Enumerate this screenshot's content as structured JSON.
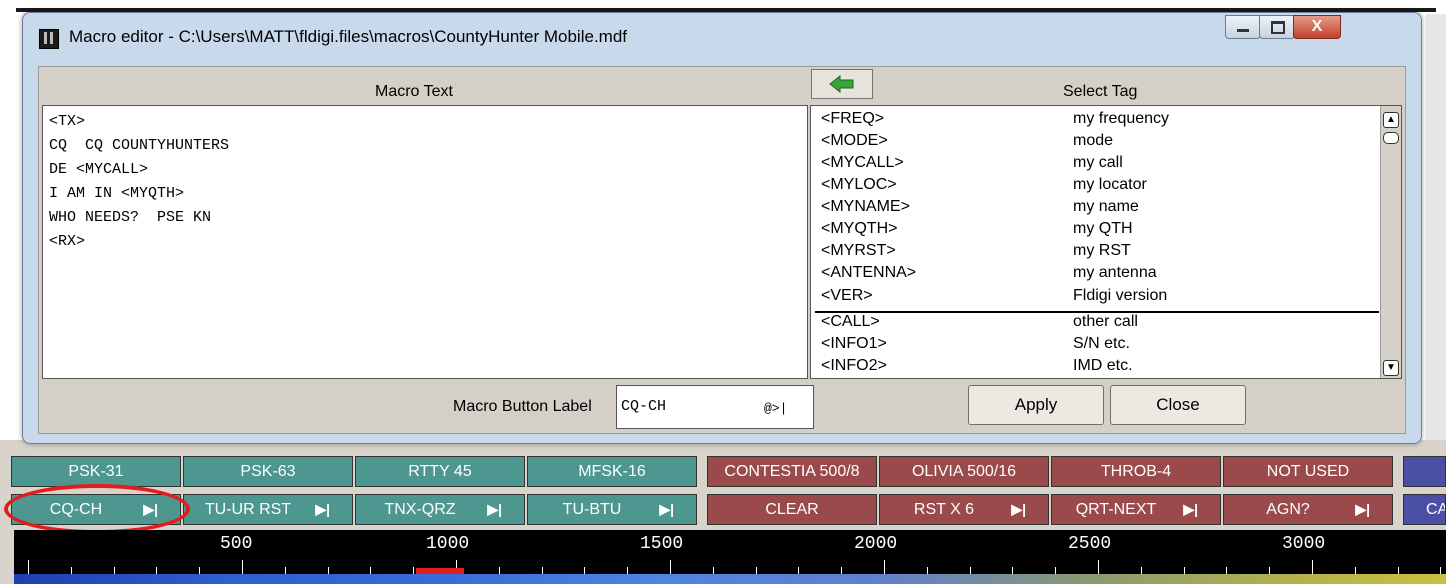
{
  "window": {
    "title": "Macro editor - C:\\Users\\MATT\\fldigi.files\\macros\\CountyHunter Mobile.mdf",
    "close_glyph": "X"
  },
  "macro_text": {
    "label": "Macro Text",
    "content": "<TX>\nCQ  CQ COUNTYHUNTERS\nDE <MYCALL>\nI AM IN <MYQTH>\nWHO NEEDS?  PSE KN\n<RX>"
  },
  "select_tag": {
    "label": "Select Tag",
    "back_icon": "green-left-arrow-icon",
    "items": [
      {
        "tag": "<FREQ>",
        "desc": "my frequency"
      },
      {
        "tag": "<MODE>",
        "desc": "mode"
      },
      {
        "tag": "<MYCALL>",
        "desc": "my call"
      },
      {
        "tag": "<MYLOC>",
        "desc": "my locator"
      },
      {
        "tag": "<MYNAME>",
        "desc": "my name"
      },
      {
        "tag": "<MYQTH>",
        "desc": "my QTH"
      },
      {
        "tag": "<MYRST>",
        "desc": "my RST"
      },
      {
        "tag": "<ANTENNA>",
        "desc": "my antenna"
      },
      {
        "tag": "<VER>",
        "desc": "Fldigi version"
      },
      {
        "tag": "<CALL>",
        "desc": "other call"
      },
      {
        "tag": "<INFO1>",
        "desc": "S/N etc."
      },
      {
        "tag": "<INFO2>",
        "desc": "IMD etc."
      }
    ]
  },
  "button_label": {
    "caption": "Macro Button Label",
    "value": "CQ-CH",
    "suffix": "@>|"
  },
  "buttons": {
    "apply": "Apply",
    "close": "Close"
  },
  "macro_bar_row1": [
    {
      "label": "PSK-31",
      "color": "teal"
    },
    {
      "label": "PSK-63",
      "color": "teal"
    },
    {
      "label": "RTTY 45",
      "color": "teal"
    },
    {
      "label": "MFSK-16",
      "color": "teal"
    },
    {
      "label": "CONTESTIA 500/8",
      "color": "red"
    },
    {
      "label": "OLIVIA 500/16",
      "color": "red"
    },
    {
      "label": "THROB-4",
      "color": "red"
    },
    {
      "label": "NOT USED",
      "color": "red"
    }
  ],
  "macro_bar_row2": [
    {
      "label": "CQ-CH",
      "color": "teal",
      "play": true
    },
    {
      "label": "TU-UR RST",
      "color": "teal",
      "play": true
    },
    {
      "label": "TNX-QRZ",
      "color": "teal",
      "play": true
    },
    {
      "label": "TU-BTU",
      "color": "teal",
      "play": true
    },
    {
      "label": "CLEAR",
      "color": "red",
      "play": false
    },
    {
      "label": "RST X 6",
      "color": "red",
      "play": true
    },
    {
      "label": "QRT-NEXT",
      "color": "red",
      "play": true
    },
    {
      "label": "AGN?",
      "color": "red",
      "play": true
    },
    {
      "label": "CA",
      "color": "blue",
      "play": false
    }
  ],
  "frequency_scale": {
    "labels": [
      "500",
      "1000",
      "1500",
      "2000",
      "2500",
      "3000"
    ]
  },
  "colors": {
    "teal_button": "#4e9791",
    "red_button": "#9a4a4a",
    "blue_button": "#4b4fa3",
    "highlight": "#e31c1c"
  }
}
